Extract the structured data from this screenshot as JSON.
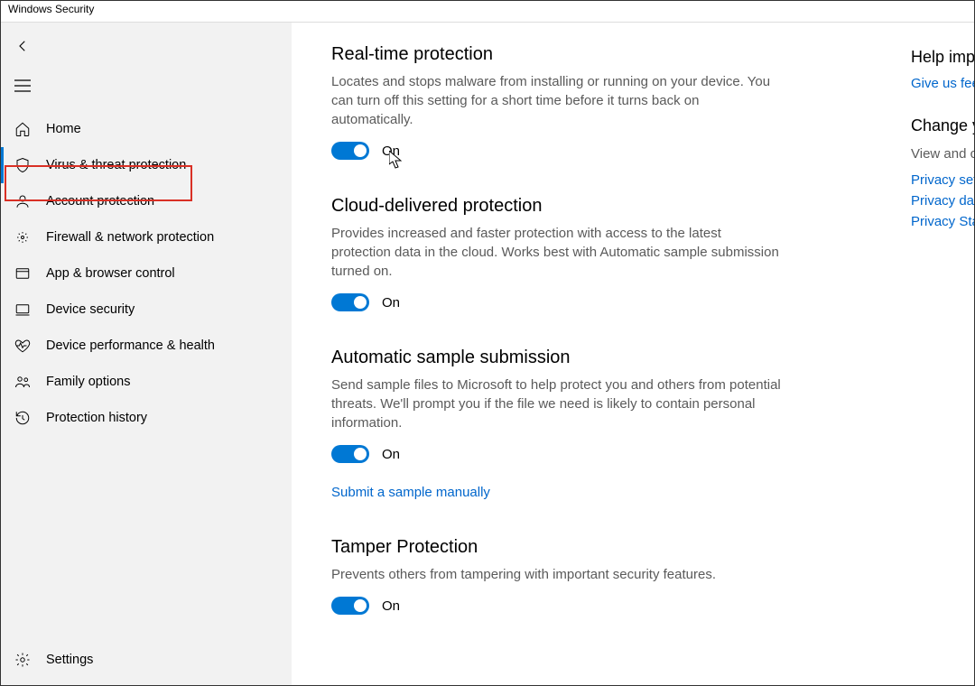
{
  "window": {
    "title": "Windows Security"
  },
  "sidebar": {
    "items": [
      {
        "label": "Home"
      },
      {
        "label": "Virus & threat protection"
      },
      {
        "label": "Account protection"
      },
      {
        "label": "Firewall & network protection"
      },
      {
        "label": "App & browser control"
      },
      {
        "label": "Device security"
      },
      {
        "label": "Device performance & health"
      },
      {
        "label": "Family options"
      },
      {
        "label": "Protection history"
      }
    ],
    "settings_label": "Settings"
  },
  "main": {
    "sections": [
      {
        "title": "Real-time protection",
        "desc": "Locates and stops malware from installing or running on your device. You can turn off this setting for a short time before it turns back on automatically.",
        "toggle_state": "On"
      },
      {
        "title": "Cloud-delivered protection",
        "desc": "Provides increased and faster protection with access to the latest protection data in the cloud. Works best with Automatic sample submission turned on.",
        "toggle_state": "On"
      },
      {
        "title": "Automatic sample submission",
        "desc": "Send sample files to Microsoft to help protect you and others from potential threats. We'll prompt you if the file we need is likely to contain personal information.",
        "toggle_state": "On",
        "link": "Submit a sample manually"
      },
      {
        "title": "Tamper Protection",
        "desc": "Prevents others from tampering with important security features.",
        "toggle_state": "On"
      }
    ]
  },
  "right": {
    "help": {
      "title": "Help improve Windows Security",
      "link": "Give us feedback"
    },
    "privacy": {
      "title": "Change your privacy settings",
      "desc": "View and change privacy settings for your Windows device.",
      "links": [
        "Privacy settings",
        "Privacy dashboard",
        "Privacy Statement"
      ]
    }
  }
}
